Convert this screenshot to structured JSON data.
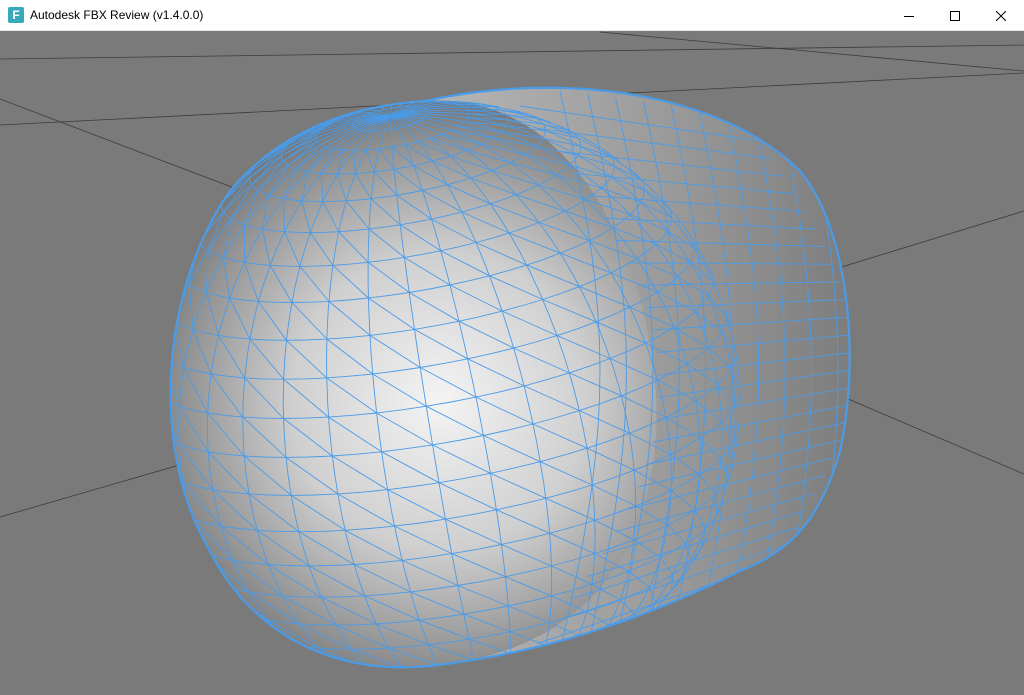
{
  "window": {
    "title": "Autodesk FBX Review (v1.4.0.0)",
    "app_icon_letter": "F",
    "controls": {
      "minimize": "minimize-icon",
      "maximize": "maximize-icon",
      "close": "close-icon"
    }
  },
  "viewport": {
    "background_color": "#7a7a7a",
    "grid_line_color": "#3c3c3c",
    "mesh_wire_color": "#4a9be8",
    "shading_highlight": "#f4f4f4",
    "shading_shadow": "#5e5e5e",
    "model": "capsule-wireframe-mesh"
  }
}
